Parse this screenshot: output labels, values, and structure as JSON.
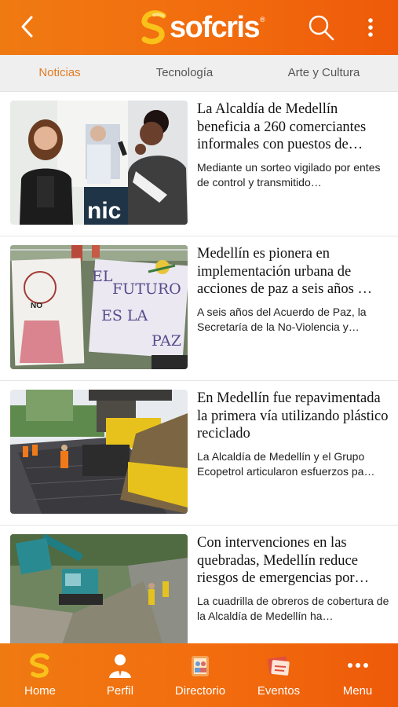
{
  "app": {
    "logo_text": "sofcris",
    "logo_reg": "®"
  },
  "header": {
    "back_icon": "chevron-left-icon",
    "search_icon": "search-icon",
    "more_icon": "more-vertical-icon"
  },
  "tabs": [
    {
      "label": "Noticias",
      "active": true
    },
    {
      "label": "Tecnología",
      "active": false
    },
    {
      "label": "Arte y Cultura",
      "active": false
    }
  ],
  "articles": [
    {
      "title": "La Alcaldía de Medellín beneficia a 260 comerciantes informales con puestos de…",
      "excerpt": "Mediante un sorteo vigilado por entes de control y transmitido…",
      "image_text": "nic"
    },
    {
      "title": "Medellín es pionera en implementación urbana de acciones de paz a seis años …",
      "excerpt": "A seis años del Acuerdo de Paz, la Secretaría de la No-Violencia y…",
      "image_text": [
        "EL",
        "FUTURO",
        "ES LA",
        "PAZ"
      ],
      "image_text_small": "NO"
    },
    {
      "title": "En Medellín fue repavimentada la primera vía utilizando plástico reciclado",
      "excerpt": "La Alcaldía de Medellín y el Grupo Ecopetrol articularon esfuerzos pa…"
    },
    {
      "title": "Con intervenciones en las quebradas, Medellín reduce riesgos de emergencias por…",
      "excerpt": "La cuadrilla de obreros de cobertura de la Alcaldía de Medellín ha…"
    }
  ],
  "bottom_nav": [
    {
      "label": "Home",
      "icon": "sofcris-logo-icon"
    },
    {
      "label": "Perfil",
      "icon": "user-icon"
    },
    {
      "label": "Directorio",
      "icon": "directory-icon"
    },
    {
      "label": "Eventos",
      "icon": "events-icon"
    },
    {
      "label": "Menu",
      "icon": "more-horizontal-icon"
    }
  ],
  "colors": {
    "brand_orange": "#f26c0e",
    "active_tab": "#e07b24",
    "tab_bar": "#efefef"
  }
}
